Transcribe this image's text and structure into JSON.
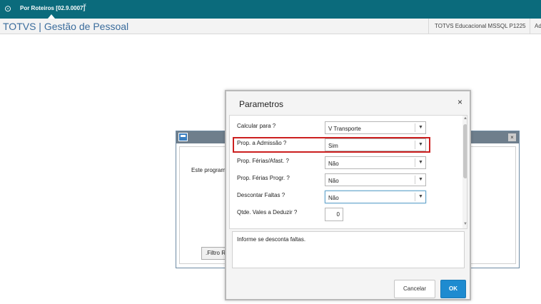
{
  "topbar": {
    "app_icon": "logo-circle-icon",
    "tab_label": "Por Roteiros [02.9.0007]",
    "tab_close": "×"
  },
  "header": {
    "title": "TOTVS | Gestão de Pessoal",
    "environment": "TOTVS Educacional MSSQL P1225",
    "user": "Ad"
  },
  "background_window": {
    "body_text": "Este program",
    "filter_button": ".Filtro Ra"
  },
  "dialog": {
    "title": "Parametros",
    "close": "×",
    "params": [
      {
        "label": "Calcular para ?",
        "value": "V Transporte",
        "arrow": "▼"
      },
      {
        "label": "Prop. a Admissão ?",
        "value": "Sim",
        "arrow": "▼"
      },
      {
        "label": "Prop. Férias/Afast. ?",
        "value": "Não",
        "arrow": "▼"
      },
      {
        "label": "Prop. Férias Progr. ?",
        "value": "Não",
        "arrow": "▼"
      },
      {
        "label": "Descontar Faltas ?",
        "value": "Não",
        "arrow": "▼"
      },
      {
        "label": "Qtde. Vales a Deduzir ?",
        "value": "0"
      }
    ],
    "scroll_up": "▲",
    "scroll_down": "▼",
    "help_text": "Informe se desconta faltas.",
    "cancel_label": "Cancelar",
    "ok_label": "OK"
  },
  "colors": {
    "topbar": "#0b6b7c",
    "title_text": "#3a6c9c",
    "highlight_border": "#cc1f1f",
    "ok_button": "#1e8bd0"
  }
}
